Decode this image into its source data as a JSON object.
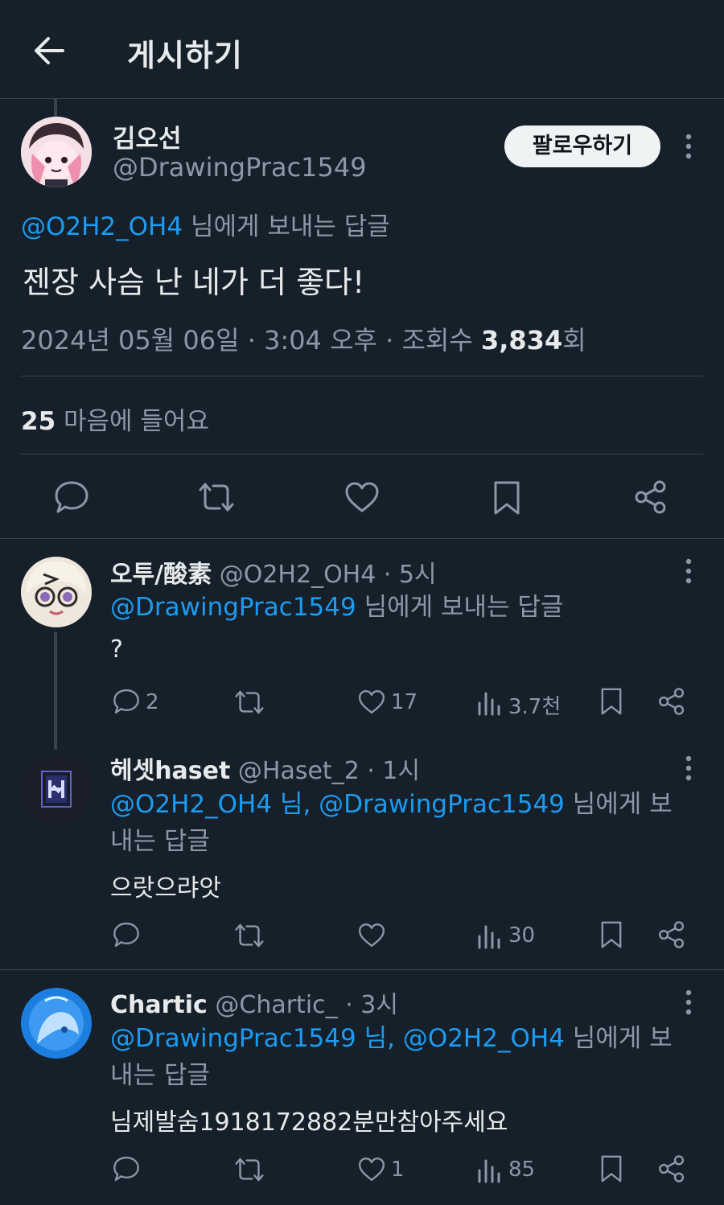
{
  "header": {
    "title": "게시하기",
    "back_icon": "arrow-left-icon"
  },
  "colors": {
    "background": "#15202b",
    "text": "#e7e9ea",
    "muted": "#8b98a5",
    "link": "#1d9bf0",
    "divider": "#38444d"
  },
  "main_post": {
    "display_name": "김오선",
    "handle": "@DrawingPrac1549",
    "follow_label": "팔로우하기",
    "reply_to_handle": "@O2H2_OH4",
    "reply_to_suffix": " 님에게 보내는 답글",
    "text": "젠장 사슴 난 네가 더 좋다!",
    "timestamp": "2024년 05월 06일 · 3:04 오후 · 조회수 ",
    "views": "3,834",
    "views_suffix": "회",
    "likes_count": "25",
    "likes_label": " 마음에 들어요"
  },
  "replies": [
    {
      "display_name": "오투/酸素",
      "handle": "@O2H2_OH4",
      "time": " · 5시",
      "reply_to_links": "@DrawingPrac1549",
      "reply_to_suffix": " 님에게 보내는 답글",
      "text": "?",
      "reply_count": "2",
      "retweet_count": "",
      "like_count": "17",
      "view_count": "3.7천"
    },
    {
      "display_name": "헤셋haset",
      "handle": "@Haset_2",
      "time": " · 1시",
      "reply_to_links": "@O2H2_OH4 님, @DrawingPrac1549",
      "reply_to_suffix": " 님에게 보내는 답글",
      "text": "으랏으랴앗",
      "reply_count": "",
      "retweet_count": "",
      "like_count": "",
      "view_count": "30"
    },
    {
      "display_name": "Chartic",
      "handle": "@Chartic_",
      "time": " · 3시",
      "reply_to_links": "@DrawingPrac1549 님, @O2H2_OH4",
      "reply_to_suffix": " 님에게 보내는 답글",
      "text": "님제발숨1918172882분만참아주세요",
      "reply_count": "",
      "retweet_count": "",
      "like_count": "1",
      "view_count": "85"
    }
  ]
}
